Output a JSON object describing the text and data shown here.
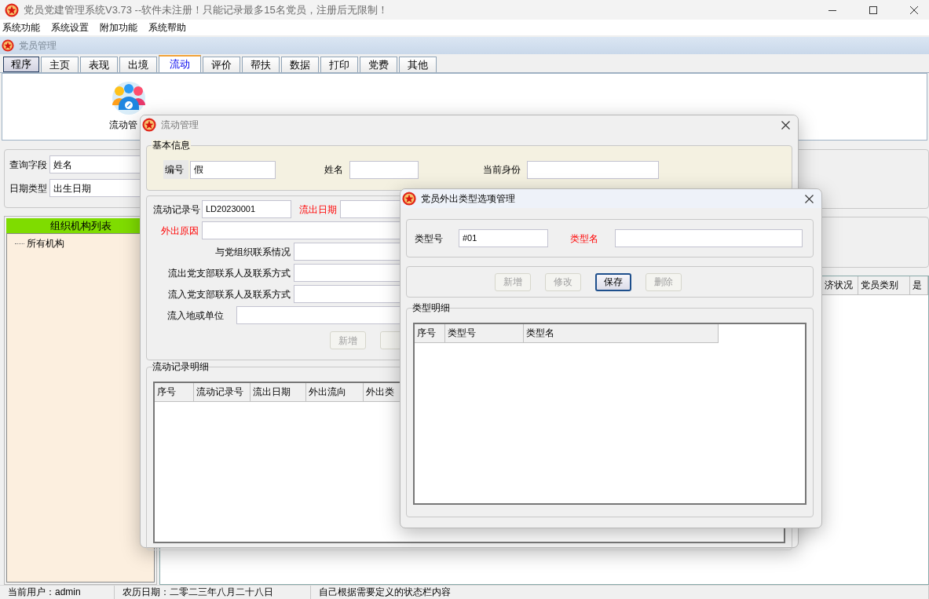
{
  "window": {
    "title": "党员党建管理系统V3.73 --软件未注册！只能记录最多15名党员，注册后无限制！"
  },
  "menu": [
    "系统功能",
    "系统设置",
    "附加功能",
    "系统帮助"
  ],
  "mdi_title": "党员管理",
  "tabs": [
    {
      "label": "程序",
      "selected": false,
      "pressed": true
    },
    {
      "label": "主页",
      "selected": false,
      "pressed": false
    },
    {
      "label": "表现",
      "selected": false,
      "pressed": false
    },
    {
      "label": "出境",
      "selected": false,
      "pressed": false
    },
    {
      "label": "流动",
      "selected": true,
      "pressed": false
    },
    {
      "label": "评价",
      "selected": false,
      "pressed": false
    },
    {
      "label": "帮扶",
      "selected": false,
      "pressed": false
    },
    {
      "label": "数据",
      "selected": false,
      "pressed": false
    },
    {
      "label": "打印",
      "selected": false,
      "pressed": false
    },
    {
      "label": "党费",
      "selected": false,
      "pressed": false
    },
    {
      "label": "其他",
      "selected": false,
      "pressed": false
    }
  ],
  "ribbon": {
    "items": [
      {
        "label": "流动管"
      }
    ]
  },
  "query": {
    "fields": [
      {
        "label": "查询字段",
        "value": "姓名"
      },
      {
        "label": "日期类型",
        "value": "出生日期"
      }
    ]
  },
  "org_tree": {
    "title": "组织机构列表",
    "items": [
      {
        "label": "所有机构"
      }
    ]
  },
  "member_table": {
    "columns": [
      "济状况",
      "党员类别",
      "是"
    ]
  },
  "status_bar": [
    "当前用户：admin",
    "农历日期：二零二三年八月二十八日",
    "自己根据需要定义的状态栏内容"
  ],
  "flow_dialog": {
    "title": "流动管理",
    "active": false,
    "basic_info": {
      "legend": "基本信息",
      "fields": [
        {
          "label": "编号",
          "value": "假"
        },
        {
          "label": "姓名"
        },
        {
          "label": "当前身份"
        }
      ]
    },
    "record_rows": [
      [
        {
          "label": "流动记录号",
          "value": "LD20230001",
          "required": false
        },
        {
          "label": "流出日期",
          "required": true
        }
      ],
      [
        {
          "label": "外出原因",
          "required": true
        }
      ],
      [
        {
          "label": "与党组织联系情况",
          "required": false
        }
      ],
      [
        {
          "label": "流出党支部联系人及联系方式",
          "required": false
        }
      ],
      [
        {
          "label": "流入党支部联系人及联系方式",
          "required": false
        }
      ],
      [
        {
          "label": "流入地或单位",
          "required": false
        }
      ]
    ],
    "buttons": [
      {
        "label": "新增",
        "disabled": true
      },
      {
        "disabled": true
      }
    ],
    "detail": {
      "legend": "流动记录明细",
      "columns": [
        "序号",
        "流动记录号",
        "流出日期",
        "外出流向",
        "外出类"
      ]
    }
  },
  "type_dialog": {
    "title": "党员外出类型选项管理",
    "active": true,
    "fields": [
      {
        "label": "类型号",
        "value": "#01",
        "required": false
      },
      {
        "label": "类型名",
        "required": true
      }
    ],
    "buttons": [
      {
        "label": "新增",
        "disabled": true,
        "focused": false
      },
      {
        "label": "修改",
        "disabled": true,
        "focused": false
      },
      {
        "label": "保存",
        "disabled": false,
        "focused": true
      },
      {
        "label": "删除",
        "disabled": true,
        "focused": false
      }
    ],
    "detail": {
      "legend": "类型明细",
      "columns": [
        "序号",
        "类型号",
        "类型名"
      ]
    }
  }
}
